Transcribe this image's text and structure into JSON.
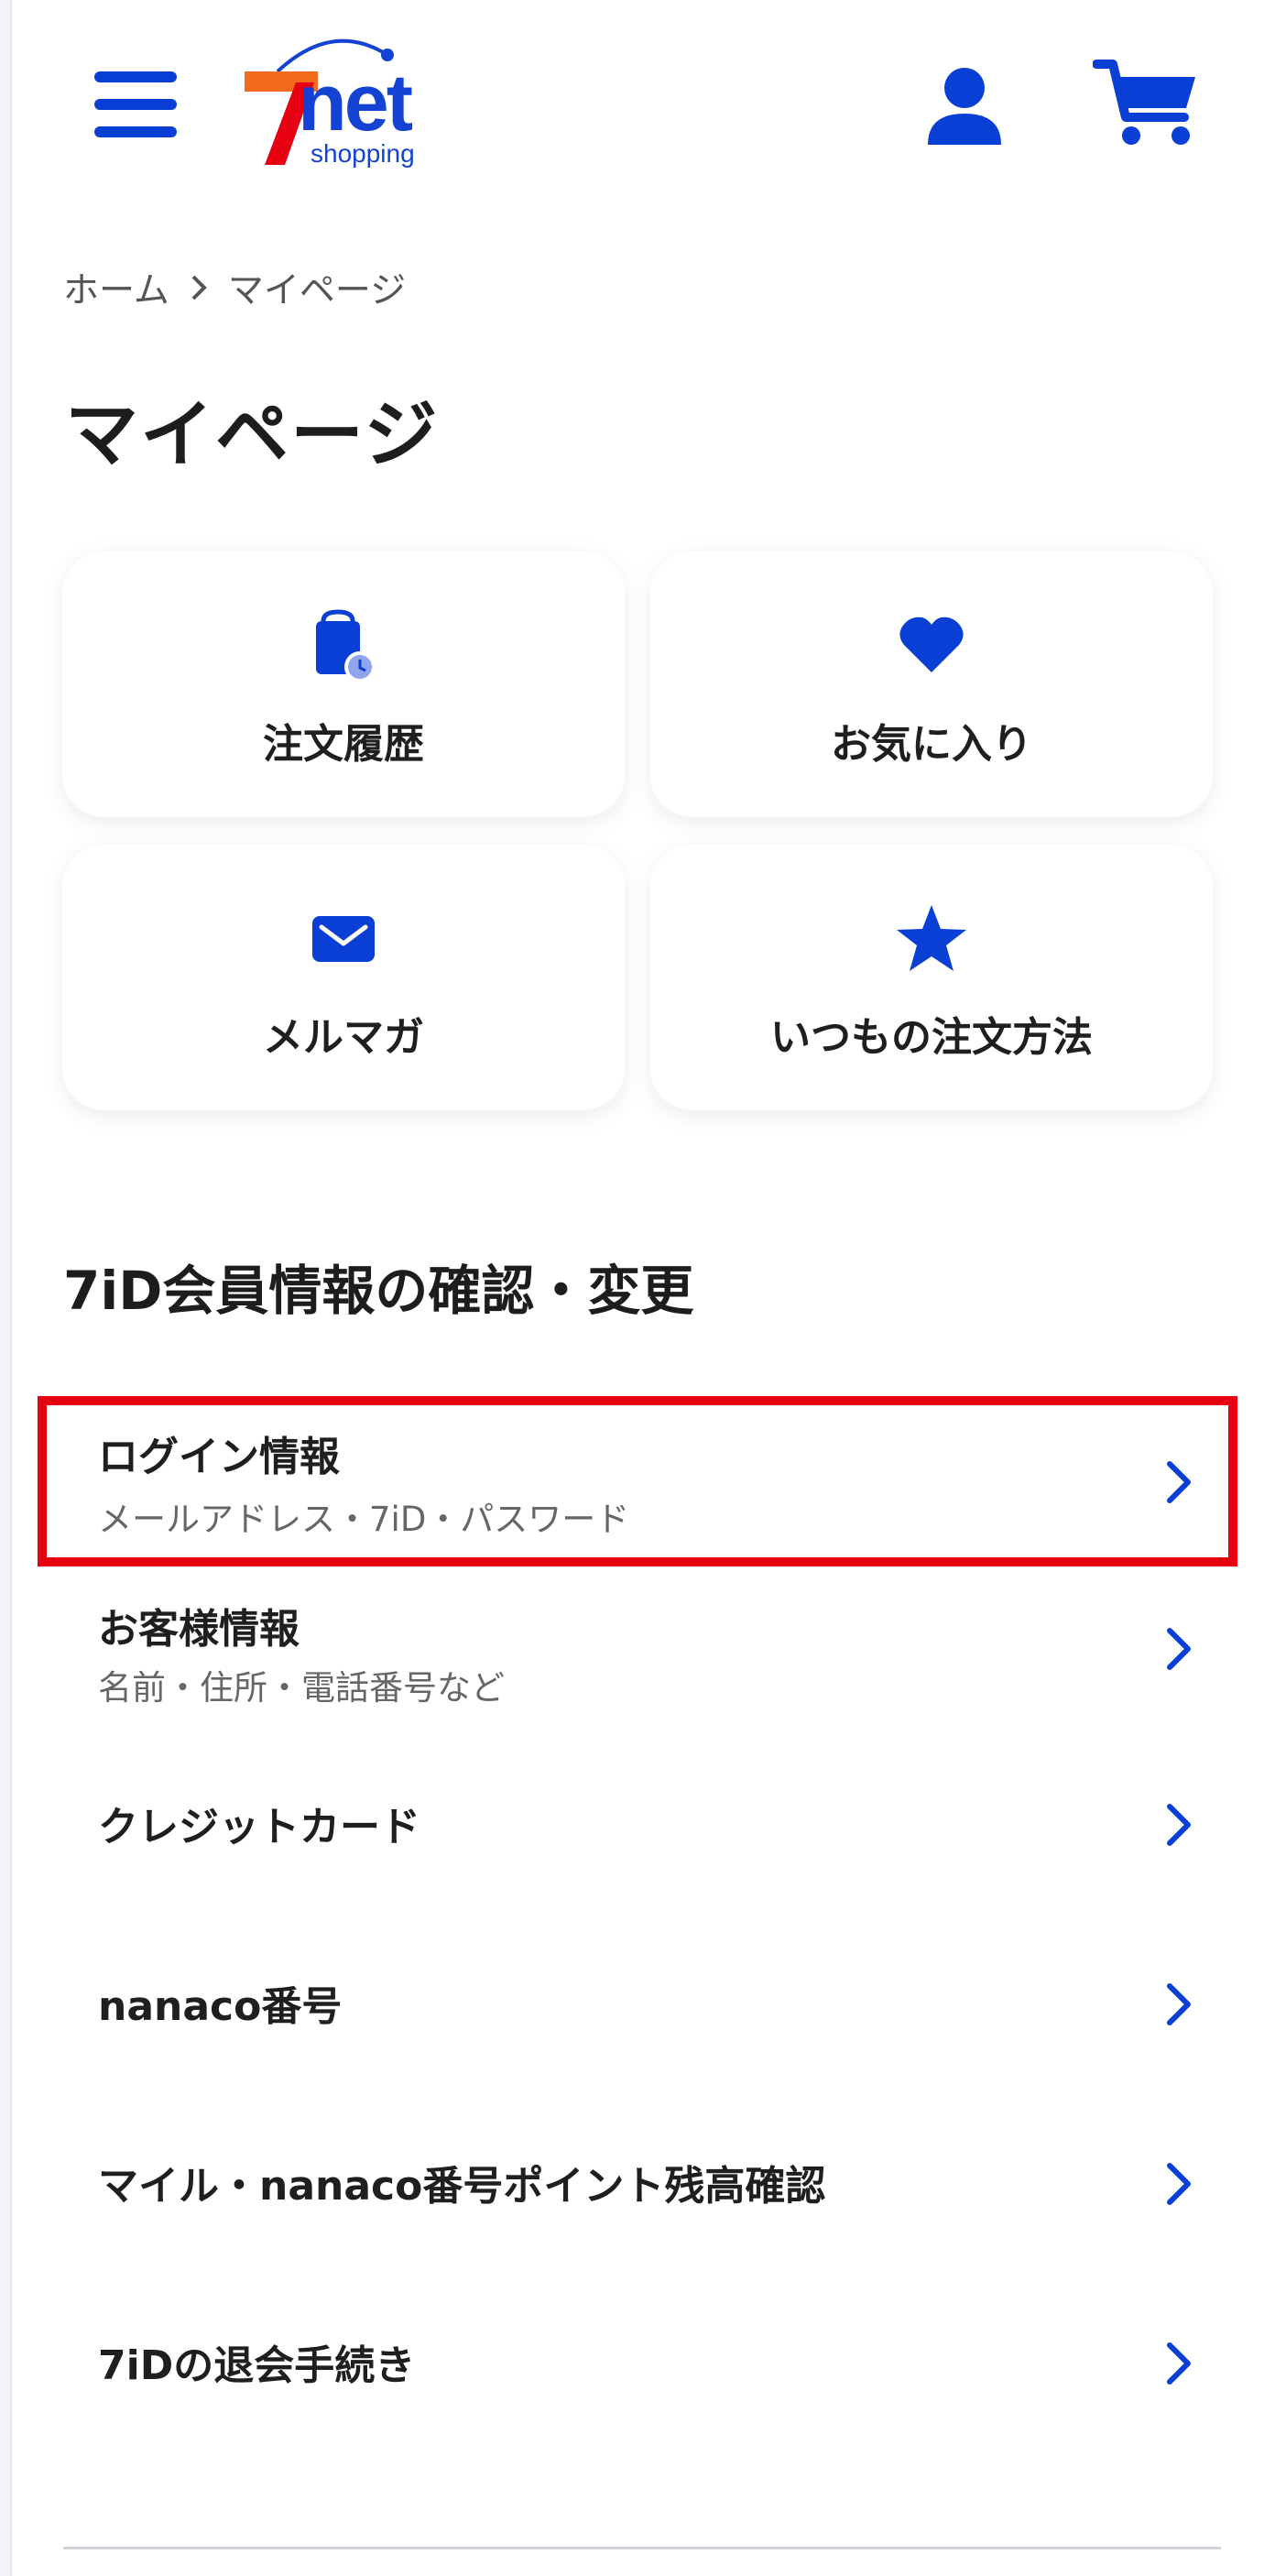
{
  "header": {
    "logo_text": "net",
    "logo_sub": "shopping",
    "logo_seven": "7",
    "menu_icon": "hamburger-icon",
    "account_icon": "user-icon",
    "cart_icon": "cart-icon"
  },
  "breadcrumb": {
    "home": "ホーム",
    "current": "マイページ"
  },
  "page_title": "マイページ",
  "tiles": [
    {
      "label": "注文履歴",
      "icon": "shopping-bag-clock-icon"
    },
    {
      "label": "お気に入り",
      "icon": "heart-icon"
    },
    {
      "label": "メルマガ",
      "icon": "mail-icon"
    },
    {
      "label": "いつもの注文方法",
      "icon": "star-icon"
    }
  ],
  "section_title": "7iD会員情報の確認・変更",
  "rows": [
    {
      "title": "ログイン情報",
      "subtitle": "メールアドレス・7iD・パスワード"
    },
    {
      "title": "お客様情報",
      "subtitle": "名前・住所・電話番号など"
    },
    {
      "title": "クレジットカード"
    },
    {
      "title": "nanaco番号"
    },
    {
      "title": "マイル・nanaco番号ポイント残高確認"
    },
    {
      "title": "7iDの退会手続き"
    }
  ],
  "colors": {
    "accent": "#0a3fd6",
    "highlight": "#e60012",
    "logo_orange": "#f26b1d",
    "logo_red": "#e60012"
  }
}
